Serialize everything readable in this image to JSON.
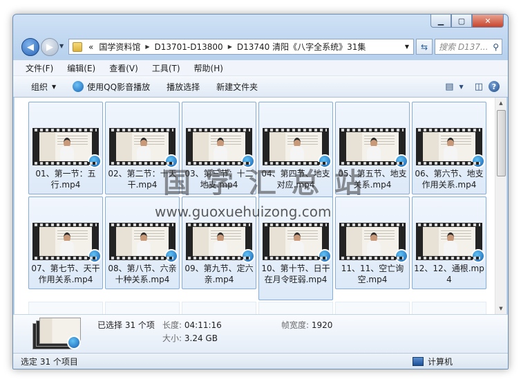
{
  "address": {
    "overflow_marker": "«",
    "crumbs": [
      "国学资料馆",
      "D13701-D13800",
      "D13740 清阳《八字全系统》31集"
    ]
  },
  "search": {
    "placeholder": "搜索 D137..."
  },
  "menu": [
    "文件(F)",
    "编辑(E)",
    "查看(V)",
    "工具(T)",
    "帮助(H)"
  ],
  "toolbar": {
    "organize": "组织",
    "play_qq": "使用QQ影音播放",
    "play_select": "播放选择",
    "new_folder": "新建文件夹"
  },
  "files": [
    "01、第一节：五行.mp4",
    "02、第二节：十天干.mp4",
    "03、第三节：十二地支.mp4",
    "04、第四节、地支对应.mp4",
    "05、第五节、地支关系.mp4",
    "06、第六节、地支作用关系.mp4",
    "07、第七节、天干作用关系.mp4",
    "08、第八节、六亲十种关系.mp4",
    "09、第九节、定六亲.mp4",
    "10、第十节、日干在月令旺弱.mp4",
    "11、11、空亡询空.mp4",
    "12、12、通根.mp4"
  ],
  "details": {
    "selected": "已选择 31 个项",
    "length_key": "长度:",
    "length_val": "04:11:16",
    "size_key": "大小:",
    "size_val": "3.24 GB",
    "width_key": "帧宽度:",
    "width_val": "1920"
  },
  "status": {
    "left": "选定 31 个项目",
    "right": "计算机"
  },
  "watermark": {
    "text": "国学汇总站",
    "url": "www.guoxuehuizong.com"
  },
  "colors": {
    "selection_border": "#84acdd",
    "qq_blue": "#135fb3"
  }
}
